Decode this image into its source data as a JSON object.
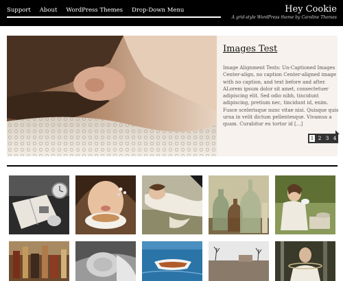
{
  "header": {
    "nav": [
      "Support",
      "About",
      "WordPress Themes",
      "Drop-Down Menu"
    ],
    "site_title": "Hey Cookie",
    "tagline": "A grid-style WordPress theme by Caroline Themes"
  },
  "featured": {
    "title": "Images Test",
    "excerpt": "Image Alignment Tests: Un-Captioned Images Center-align, no caption Center-aligned image with no caption, and text before and after. ALorem ipsum dolor sit amet, consectetuer adipiscing elit. Sed odio nibh, tincidunt adipiscing, pretium nec, tincidunt id, enim. Fusce scelerisque nunc vitae nisi. Quisque quis urna in velit dictum pellentesque. Vivamus a quam. Curabitur eu tortor id [...]",
    "pager": [
      "1",
      "2",
      "3",
      "4"
    ],
    "active_slide": "1"
  },
  "grid": {
    "thumbs": [
      "book-and-clock-photo",
      "woman-drinking-tea-photo",
      "woman-lying-in-grass-photo",
      "glass-bottles-photo",
      "woman-with-teacup-photo",
      "bottles-on-table-photo",
      "sleeping-child-photo",
      "rowboat-on-water-photo",
      "winter-field-photo",
      "woman-in-forest-photo"
    ]
  }
}
